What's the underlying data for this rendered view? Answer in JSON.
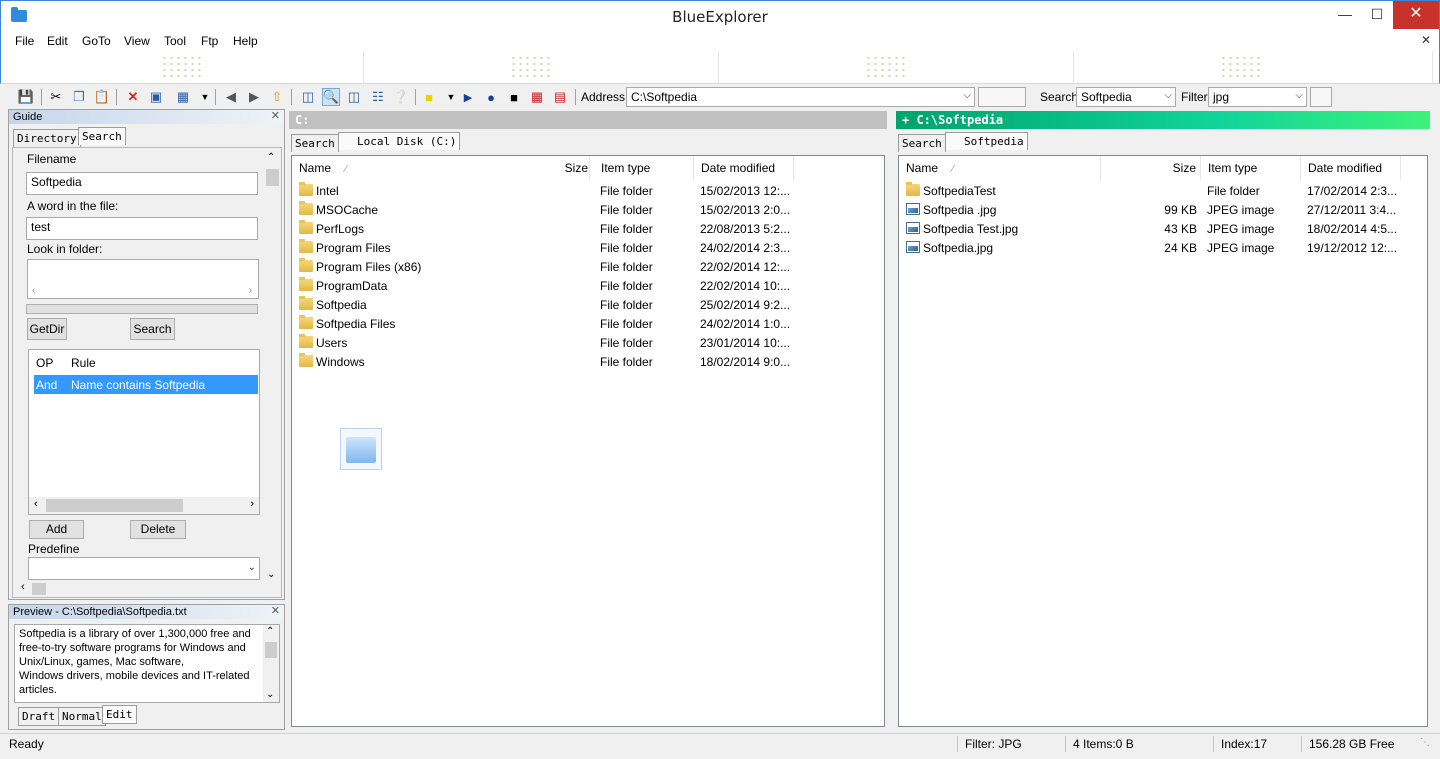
{
  "window": {
    "title": "BlueExplorer"
  },
  "menu": [
    "File",
    "Edit",
    "GoTo",
    "View",
    "Tool",
    "Ftp",
    "Help"
  ],
  "toolbar": {
    "address_label": "Address",
    "address_value": "C:\\Softpedia",
    "search_label": "Search",
    "search_value": "Softpedia",
    "filter_label": "Filter",
    "filter_value": "jpg"
  },
  "guide": {
    "title": "Guide",
    "tabs": [
      "Directory",
      "Search"
    ],
    "filename_label": "Filename",
    "filename_value": "Softpedia",
    "word_label": "A word in the file:",
    "word_value": "test",
    "folder_label": "Look in folder:",
    "getdir_label": "GetDir",
    "search_label": "Search",
    "rules_headers": [
      "OP",
      "Rule"
    ],
    "rules": [
      {
        "op": "And",
        "rule": "Name contains Softpedia"
      }
    ],
    "add_label": "Add",
    "delete_label": "Delete",
    "predefine_label": "Predefine"
  },
  "preview": {
    "title": "Preview - C:\\Softpedia\\Softpedia.txt",
    "lines": [
      "Softpedia is a library of over 1,300,000 free and",
      "free-to-try software programs for Windows and",
      "Unix/Linux, games, Mac software,",
      "Windows drivers, mobile devices and IT-related",
      "articles."
    ],
    "tabs": [
      "Draft",
      "Normal",
      "Edit"
    ]
  },
  "left_pane": {
    "path": "C:",
    "tabs": [
      "Search",
      "Local Disk (C:)"
    ],
    "headers": [
      "Name",
      "Size",
      "Item type",
      "Date modified"
    ],
    "rows": [
      {
        "name": "Intel",
        "size": "",
        "type": "File folder",
        "date": "15/02/2013 12:...",
        "icon": "folder-icon"
      },
      {
        "name": "MSOCache",
        "size": "",
        "type": "File folder",
        "date": "15/02/2013 2:0...",
        "icon": "folder-icon"
      },
      {
        "name": "PerfLogs",
        "size": "",
        "type": "File folder",
        "date": "22/08/2013 5:2...",
        "icon": "folder-icon"
      },
      {
        "name": "Program Files",
        "size": "",
        "type": "File folder",
        "date": "24/02/2014 2:3...",
        "icon": "folder-icon"
      },
      {
        "name": "Program Files (x86)",
        "size": "",
        "type": "File folder",
        "date": "22/02/2014 12:...",
        "icon": "folder-icon"
      },
      {
        "name": "ProgramData",
        "size": "",
        "type": "File folder",
        "date": "22/02/2014 10:...",
        "icon": "folder-icon"
      },
      {
        "name": "Softpedia",
        "size": "",
        "type": "File folder",
        "date": "25/02/2014 9:2...",
        "icon": "folder-icon"
      },
      {
        "name": "Softpedia Files",
        "size": "",
        "type": "File folder",
        "date": "24/02/2014 1:0...",
        "icon": "folder-icon"
      },
      {
        "name": "Users",
        "size": "",
        "type": "File folder",
        "date": "23/01/2014 10:...",
        "icon": "folder-icon"
      },
      {
        "name": "Windows",
        "size": "",
        "type": "File folder",
        "date": "18/02/2014 9:0...",
        "icon": "folder-icon"
      }
    ]
  },
  "right_pane": {
    "path": "+ C:\\Softpedia",
    "tabs": [
      "Search",
      "Softpedia"
    ],
    "headers": [
      "Name",
      "Size",
      "Item type",
      "Date modified"
    ],
    "rows": [
      {
        "name": "SoftpediaTest",
        "size": "",
        "type": "File folder",
        "date": "17/02/2014 2:3...",
        "icon": "folder-icon"
      },
      {
        "name": "Softpedia .jpg",
        "size": "99 KB",
        "type": "JPEG image",
        "date": "27/12/2011 3:4...",
        "icon": "image-icon"
      },
      {
        "name": "Softpedia Test.jpg",
        "size": "43 KB",
        "type": "JPEG image",
        "date": "18/02/2014 4:5...",
        "icon": "image-icon"
      },
      {
        "name": "Softpedia.jpg",
        "size": "24 KB",
        "type": "JPEG image",
        "date": "19/12/2012 12:...",
        "icon": "image-icon"
      }
    ]
  },
  "status": {
    "state": "Ready",
    "filter": "Filter: JPG",
    "items": "4 Items:0  B",
    "index": "Index:17",
    "free": "156.28 GB Free"
  },
  "colors": {
    "accent": "#00a36c",
    "title_border": "#3c86d8",
    "selection": "#3399ff"
  }
}
